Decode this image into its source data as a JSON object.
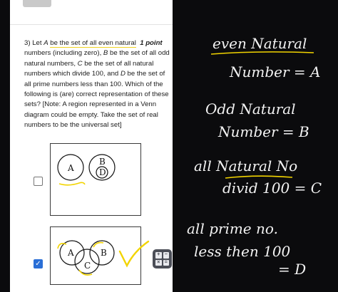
{
  "question": {
    "number": "3)",
    "text_before_hl": "Let",
    "set_a_name": "A",
    "text_hl": "be the set of all even natural",
    "points": "1 point",
    "text_line2": "numbers (including zero),",
    "set_b_name": "B",
    "text_after_b": "be the set of all odd natural numbers,",
    "set_c_name": "C",
    "text_after_c": "be the set of all natural numbers which divide 100, and",
    "set_d_name": "D",
    "text_after_d": "be the set of all prime numbers less than 100. Which of the following is (are) correct representation of these sets? [Note: A region represented in a Venn diagram could be empty. Take the set of real numbers to be the universal set]"
  },
  "options": [
    {
      "id": "opt1",
      "checked": false,
      "labels": [
        "A",
        "B",
        "D"
      ]
    },
    {
      "id": "opt2",
      "checked": true,
      "labels": [
        "A",
        "B",
        "C"
      ]
    }
  ],
  "check_mark": "✓",
  "calculator_keys": [
    "+",
    "−",
    "×",
    "="
  ],
  "handwritten_notes": [
    "even Natural",
    "Number = A",
    "Odd Natural",
    "Number = B",
    "all Natural No",
    "divid 100 = C",
    "all prime no.",
    "less then 100",
    "= D"
  ],
  "colors": {
    "highlight": "#f1d321",
    "checkbox_checked": "#2a6fd6",
    "annotation_yellow": "#f2d400",
    "background": "#0b0b0d"
  }
}
